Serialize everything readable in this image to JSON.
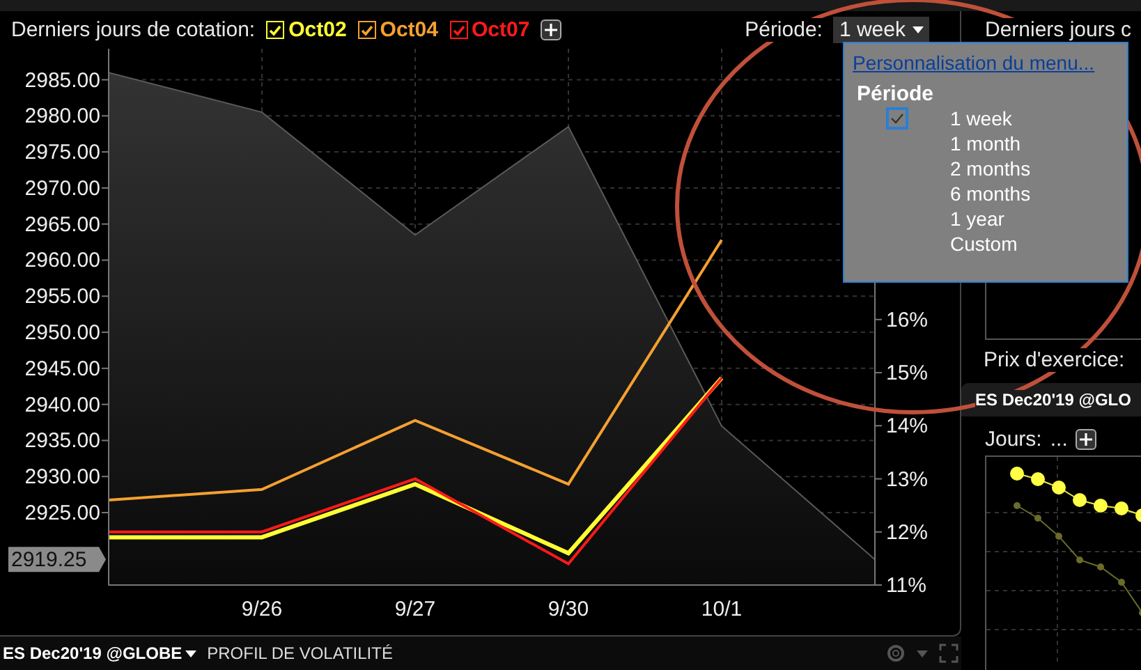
{
  "main_panel": {
    "header": {
      "label": "Derniers jours de cotation:",
      "period_label": "Période:",
      "period_value": "1 week",
      "legend": [
        {
          "label": "Oct02",
          "checked": true,
          "color": "#ffff33"
        },
        {
          "label": "Oct04",
          "checked": true,
          "color": "#f5a030"
        },
        {
          "label": "Oct07",
          "checked": true,
          "color": "#ff1a1a"
        }
      ]
    },
    "chart_data": {
      "type": "line",
      "categories": [
        null,
        "9/26",
        "9/27",
        "9/30",
        "10/1",
        null
      ],
      "ylim": [
        2914.96,
        2989.3
      ],
      "yticks": [
        {
          "value": 2925,
          "label": "2925.00"
        },
        {
          "value": 2930,
          "label": "2930.00"
        },
        {
          "value": 2935,
          "label": "2935.00"
        },
        {
          "value": 2940,
          "label": "2940.00"
        },
        {
          "value": 2945,
          "label": "2945.00"
        },
        {
          "value": 2950,
          "label": "2950.00"
        },
        {
          "value": 2955,
          "label": "2955.00"
        },
        {
          "value": 2960,
          "label": "2960.00"
        },
        {
          "value": 2965,
          "label": "2965.00"
        },
        {
          "value": 2970,
          "label": "2970.00"
        },
        {
          "value": 2975,
          "label": "2975.00"
        },
        {
          "value": 2980,
          "label": "2980.00"
        },
        {
          "value": 2985,
          "label": "2985.00"
        }
      ],
      "y2lim": [
        11,
        21.1
      ],
      "y2ticks": [
        {
          "value": 11,
          "label": "11%"
        },
        {
          "value": 12,
          "label": "12%"
        },
        {
          "value": 13,
          "label": "13%"
        },
        {
          "value": 14,
          "label": "14%"
        },
        {
          "value": 15,
          "label": "15%"
        },
        {
          "value": 16,
          "label": "16%"
        }
      ],
      "grid": true,
      "series": [
        {
          "type": "area",
          "color": "#5a5a5a",
          "values": [
            2986,
            2980.5,
            2963.5,
            2978.5,
            2937,
            2918.5
          ]
        },
        {
          "type": "line",
          "color": "#ffff33",
          "axis": "y2",
          "values": [
            11.9,
            11.9,
            12.9,
            11.6,
            14.9,
            null
          ]
        },
        {
          "type": "line",
          "color": "#f5a030",
          "axis": "y2",
          "values": [
            12.6,
            12.8,
            14.1,
            12.9,
            17.5,
            null
          ]
        },
        {
          "type": "line",
          "color": "#ff1a1a",
          "axis": "y2",
          "values": [
            12.0,
            12.0,
            13.0,
            11.4,
            14.9,
            null
          ]
        }
      ]
    },
    "last_price": "2919.25",
    "footer": {
      "symbol": "ES Dec20'19 @GLOBE",
      "title": "PROFIL DE VOLATILITÉ"
    }
  },
  "side_panel": {
    "header": "Derniers jours c",
    "strike_label": "Prix d'exercice:",
    "symbol": "ES Dec20'19 @GLO",
    "days_label": "Jours:",
    "days_value": "..."
  },
  "period_menu": {
    "link": "Personnalisation du menu...",
    "heading": "Période",
    "items": [
      {
        "label": "1 week",
        "selected": true
      },
      {
        "label": "1 month",
        "selected": false
      },
      {
        "label": "2 months",
        "selected": false
      },
      {
        "label": "6 months",
        "selected": false
      },
      {
        "label": "1 year",
        "selected": false
      },
      {
        "label": "Custom",
        "selected": false
      }
    ]
  }
}
